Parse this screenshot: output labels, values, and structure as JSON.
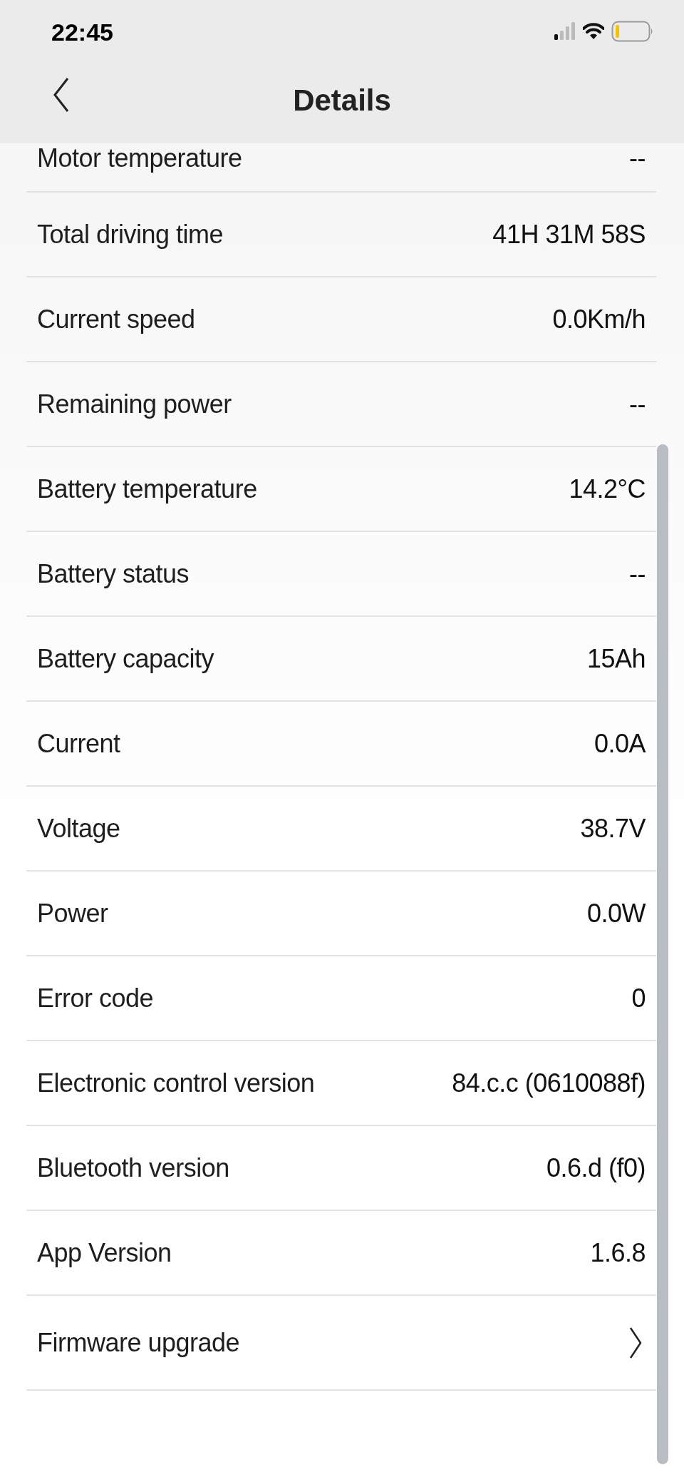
{
  "status_bar": {
    "time": "22:45"
  },
  "nav": {
    "title": "Details"
  },
  "rows": [
    {
      "kind": "value",
      "label": "Motor temperature",
      "value": "--"
    },
    {
      "kind": "value",
      "label": "Total driving time",
      "value": "41H 31M 58S"
    },
    {
      "kind": "value",
      "label": "Current speed",
      "value": "0.0Km/h"
    },
    {
      "kind": "value",
      "label": "Remaining power",
      "value": "--"
    },
    {
      "kind": "value",
      "label": "Battery temperature",
      "value": "14.2°C"
    },
    {
      "kind": "value",
      "label": "Battery status",
      "value": "--"
    },
    {
      "kind": "value",
      "label": "Battery capacity",
      "value": "15Ah"
    },
    {
      "kind": "value",
      "label": "Current",
      "value": "0.0A"
    },
    {
      "kind": "value",
      "label": "Voltage",
      "value": "38.7V"
    },
    {
      "kind": "value",
      "label": "Power",
      "value": "0.0W"
    },
    {
      "kind": "value",
      "label": "Error code",
      "value": "0"
    },
    {
      "kind": "value",
      "label": "Electronic control version",
      "value": "84.c.c (0610088f)"
    },
    {
      "kind": "value",
      "label": "Bluetooth version",
      "value": "0.6.d (f0)"
    },
    {
      "kind": "value",
      "label": "App Version",
      "value": "1.6.8"
    },
    {
      "kind": "link",
      "label": "Firmware upgrade"
    }
  ]
}
